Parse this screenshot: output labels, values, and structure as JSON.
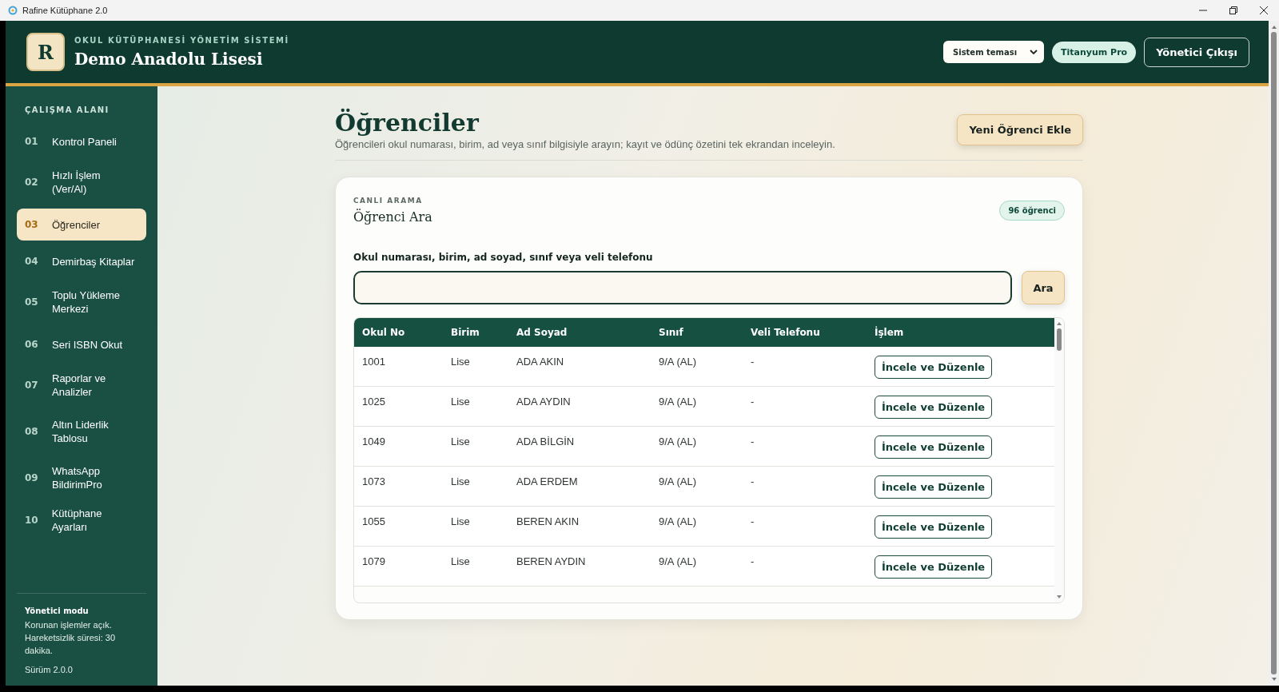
{
  "window": {
    "title": "Rafine Kütüphane 2.0"
  },
  "header": {
    "subtitle": "OKUL KÜTÜPHANESİ YÖNETİM SİSTEMİ",
    "title": "Demo Anadolu Lisesi",
    "logo": "R",
    "theme_select": "Sistem teması",
    "plan_badge": "Titanyum Pro",
    "logout": "Yönetici Çıkışı"
  },
  "sidebar": {
    "heading": "ÇALIŞMA ALANI",
    "items": [
      {
        "number": "01",
        "label": "Kontrol Paneli",
        "selected": false
      },
      {
        "number": "02",
        "label": "Hızlı İşlem (Ver/Al)",
        "selected": false
      },
      {
        "number": "03",
        "label": "Öğrenciler",
        "selected": true
      },
      {
        "number": "04",
        "label": "Demirbaş Kitaplar",
        "selected": false
      },
      {
        "number": "05",
        "label": "Toplu Yükleme Merkezi",
        "selected": false
      },
      {
        "number": "06",
        "label": "Seri ISBN Okut",
        "selected": false
      },
      {
        "number": "07",
        "label": "Raporlar ve Analizler",
        "selected": false
      },
      {
        "number": "08",
        "label": "Altın Liderlik Tablosu",
        "selected": false
      },
      {
        "number": "09",
        "label": "WhatsApp BildirimPro",
        "selected": false
      },
      {
        "number": "10",
        "label": "Kütüphane Ayarları",
        "selected": false
      }
    ],
    "footer": {
      "mode": "Yönetici modu",
      "note": "Korunan işlemler açık. Hareketsizlik süresi: 30 dakika.",
      "version": "Sürüm 2.0.0"
    }
  },
  "page": {
    "title": "Öğrenciler",
    "description": "Öğrencileri okul numarası, birim, ad veya sınıf bilgisiyle arayın; kayıt ve ödünç özetini tek ekrandan inceleyin.",
    "add_button": "Yeni Öğrenci Ekle"
  },
  "search_card": {
    "eyebrow": "CANLI ARAMA",
    "title": "Öğrenci Ara",
    "count_badge": "96 öğrenci",
    "field_label": "Okul numarası, birim, ad soyad, sınıf veya veli telefonu",
    "search_button": "Ara"
  },
  "table": {
    "columns": [
      "Okul No",
      "Birim",
      "Ad Soyad",
      "Sınıf",
      "Veli Telefonu",
      "İşlem"
    ],
    "rows": [
      {
        "cells": [
          "1001",
          "Lise",
          "ADA AKIN",
          "9/A (AL)",
          "-"
        ],
        "action": "İncele ve Düzenle"
      },
      {
        "cells": [
          "1025",
          "Lise",
          "ADA AYDIN",
          "9/A (AL)",
          "-"
        ],
        "action": "İncele ve Düzenle"
      },
      {
        "cells": [
          "1049",
          "Lise",
          "ADA BİLGİN",
          "9/A (AL)",
          "-"
        ],
        "action": "İncele ve Düzenle"
      },
      {
        "cells": [
          "1073",
          "Lise",
          "ADA ERDEM",
          "9/A (AL)",
          "-"
        ],
        "action": "İncele ve Düzenle"
      },
      {
        "cells": [
          "1055",
          "Lise",
          "BEREN AKIN",
          "9/A (AL)",
          "-"
        ],
        "action": "İncele ve Düzenle"
      },
      {
        "cells": [
          "1079",
          "Lise",
          "BEREN AYDIN",
          "9/A (AL)",
          "-"
        ],
        "action": "İncele ve Düzenle"
      }
    ]
  }
}
